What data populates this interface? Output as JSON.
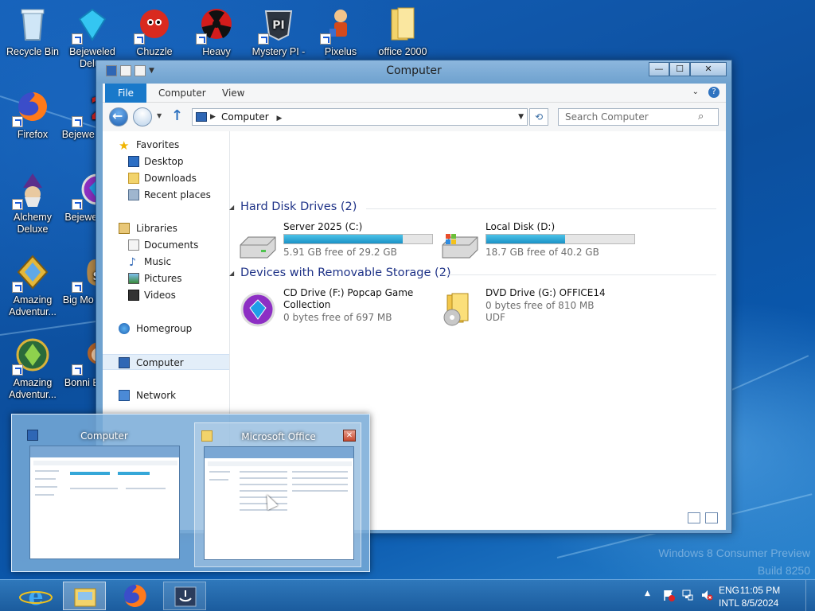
{
  "desktop": {
    "icons": [
      {
        "label": "Recycle Bin",
        "icon": "recycle-bin-icon"
      },
      {
        "label": "Bejeweled Delux",
        "icon": "bejeweled-icon"
      },
      {
        "label": "Chuzzle",
        "icon": "chuzzle-icon"
      },
      {
        "label": "Heavy",
        "icon": "heavy-weapon-icon"
      },
      {
        "label": "Mystery PI -",
        "icon": "mystery-pi-icon"
      },
      {
        "label": "Pixelus Deluxe",
        "icon": "pixelus-icon"
      },
      {
        "label": "office 2000",
        "icon": "folder-icon"
      },
      {
        "label": "Firefox",
        "icon": "firefox-icon"
      },
      {
        "label": "Bejewe Delux",
        "icon": "bejeweled-2-icon"
      },
      {
        "label": "Alchemy Deluxe",
        "icon": "alchemy-icon"
      },
      {
        "label": "Bejewe Twis",
        "icon": "bejeweled-twist-icon"
      },
      {
        "label": "Amazing Adventur...",
        "icon": "amazing-adventures-icon"
      },
      {
        "label": "Big Mo Delux",
        "icon": "big-money-icon"
      },
      {
        "label": "Amazing Adventur...",
        "icon": "amazing-adventures-2-icon"
      },
      {
        "label": "Bonni Books",
        "icon": "bonnie-bookstore-icon"
      }
    ],
    "watermark_line1": "Windows 8 Consumer Preview",
    "watermark_line2": "Build 8250"
  },
  "explorer": {
    "title": "Computer",
    "window_buttons": {
      "minimize": "—",
      "maximize": "☐",
      "close": "✕"
    },
    "ribbon_tabs": [
      "File",
      "Computer",
      "View"
    ],
    "address": "Computer",
    "search_placeholder": "Search Computer",
    "nav": {
      "favorites": "Favorites",
      "desktop": "Desktop",
      "downloads": "Downloads",
      "recent": "Recent places",
      "libraries": "Libraries",
      "documents": "Documents",
      "music": "Music",
      "pictures": "Pictures",
      "videos": "Videos",
      "homegroup": "Homegroup",
      "computer": "Computer",
      "network": "Network"
    },
    "hard_disks_header": "Hard Disk Drives (2)",
    "removable_header": "Devices with Removable Storage (2)",
    "drives": [
      {
        "name": "Server 2025 (C:)",
        "free": "5.91 GB free of 29.2 GB",
        "used_fraction": 0.8
      },
      {
        "name": "Local Disk (D:)",
        "free": "18.7 GB free of 40.2 GB",
        "used_fraction": 0.53
      }
    ],
    "removable": [
      {
        "name1": "CD Drive (F:) Popcap Game",
        "name2": "Collection",
        "free": "0 bytes free of 697 MB"
      },
      {
        "name1": "DVD Drive (G:) OFFICE14",
        "free": "0 bytes free of 810 MB",
        "fs": "UDF"
      }
    ]
  },
  "thumbnails": [
    {
      "title": "Computer"
    },
    {
      "title": "Microsoft Office",
      "close": "✕"
    }
  ],
  "tray": {
    "lang1": "ENG",
    "lang2": "INTL",
    "time": "11:05 PM",
    "date": "8/5/2024",
    "arrow": "▲"
  }
}
